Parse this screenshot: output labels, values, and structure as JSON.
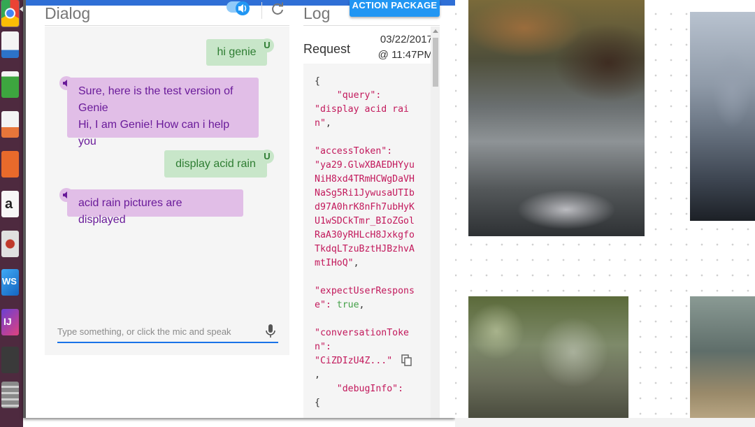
{
  "dialog": {
    "title": "Dialog",
    "messages": [
      {
        "role": "user",
        "text": "hi genie",
        "badge": "U"
      },
      {
        "role": "agent",
        "lines": [
          "Sure, here is the test version of",
          "Genie",
          "Hi, I am Genie! How can i help you"
        ]
      },
      {
        "role": "user",
        "text": "display acid rain",
        "badge": "U"
      },
      {
        "role": "agent",
        "lines": [
          "acid rain pictures are displayed"
        ]
      }
    ],
    "input_placeholder": "Type something, or click the mic and speak"
  },
  "log": {
    "title": "Log",
    "action_button": "ACTION PACKAGE",
    "request_label": "Request",
    "date": "03/22/2017",
    "time": "@ 11:47PM",
    "query_value": "\"display acid rain\"",
    "access_token_value": "\"ya29.GlwXBAEDHYyuNiH8xd4TRmHCWgDaVHNaSg5Ri1JywusaUTIbd97A0hrK8nFh7ubHyKU1wSDCkTmr_BIoZGolRaA30yRHLcH8JxkgfoTkdqLTzuBztHJBzhvAmtIHoQ\"",
    "expect_value": "true",
    "conversation_token_value": "\"CiZDIzU4Z...\""
  },
  "colors": {
    "user_bubble": "#c8e6c9",
    "user_text": "#2e7d32",
    "agent_bubble": "#e1bee7",
    "agent_text": "#6a1b9a",
    "accent": "#2196f3",
    "json_key": "#c2185b",
    "json_bool": "#43a047"
  },
  "launcher": {
    "apps": [
      "chrome-icon",
      "writer-icon",
      "calc-icon",
      "impress-icon",
      "software-center-icon",
      "amazon-icon",
      "settings-icon",
      "vscode-icon",
      "intellij-icon",
      "terminal-icon",
      "files-icon"
    ]
  }
}
